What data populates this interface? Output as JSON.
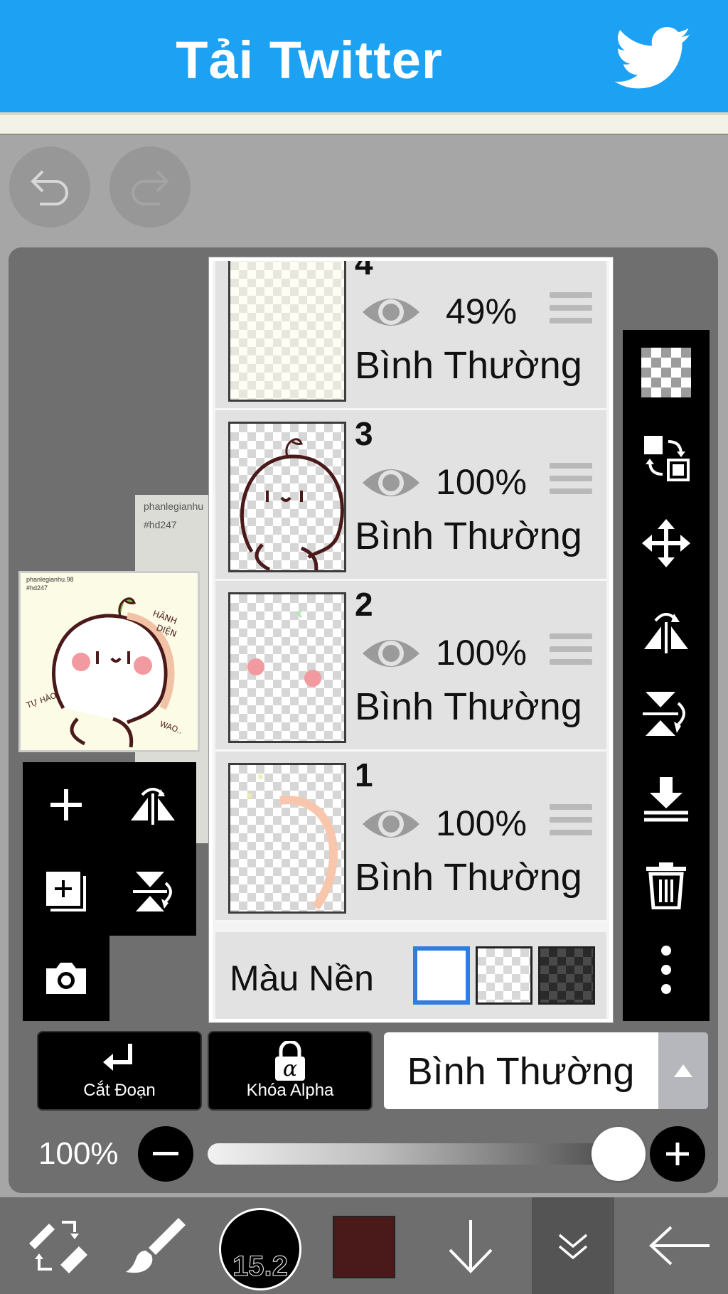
{
  "ad": {
    "title": "Tải Twitter",
    "color": "#1da1f2"
  },
  "undo": {
    "icon": "undo-icon"
  },
  "redo": {
    "icon": "redo-icon"
  },
  "canvas": {
    "paper_texts": [
      "phanlegianhu",
      "#hd247"
    ],
    "preview_texts": [
      "phanlegianhu.98",
      "#hd247"
    ]
  },
  "layers": [
    {
      "number": "4",
      "opacity": "49%",
      "blend": "Bình Thường",
      "visible": true
    },
    {
      "number": "3",
      "opacity": "100%",
      "blend": "Bình Thường",
      "visible": true
    },
    {
      "number": "2",
      "opacity": "100%",
      "blend": "Bình Thường",
      "visible": true
    },
    {
      "number": "1",
      "opacity": "100%",
      "blend": "Bình Thường",
      "visible": true
    }
  ],
  "background_row": {
    "label": "Màu Nền",
    "selected": "white"
  },
  "left_tools": [
    "add-layer-icon",
    "flip-horizontal-icon",
    "add-layer-copy-icon",
    "flip-vertical-icon",
    "camera-icon"
  ],
  "right_tools": [
    "transparency-icon",
    "swap-layer-icon",
    "move-icon",
    "flip-horizontal-icon",
    "flip-vertical-icon",
    "merge-down-icon",
    "trash-icon",
    "more-icon"
  ],
  "layer_controls": {
    "clip_label": "Cắt Đoạn",
    "alpha_label": "Khóa Alpha",
    "blend_value": "Bình Thường"
  },
  "opacity": {
    "label": "100%",
    "value": 1.0
  },
  "bottom_bar": {
    "brush_size": "15.2",
    "color": "#4a1a1a",
    "items": [
      "transform-icon",
      "brush-icon",
      "brush-size",
      "color-swatch",
      "down-arrow-icon",
      "layer-collapse-icon",
      "back-icon"
    ]
  }
}
